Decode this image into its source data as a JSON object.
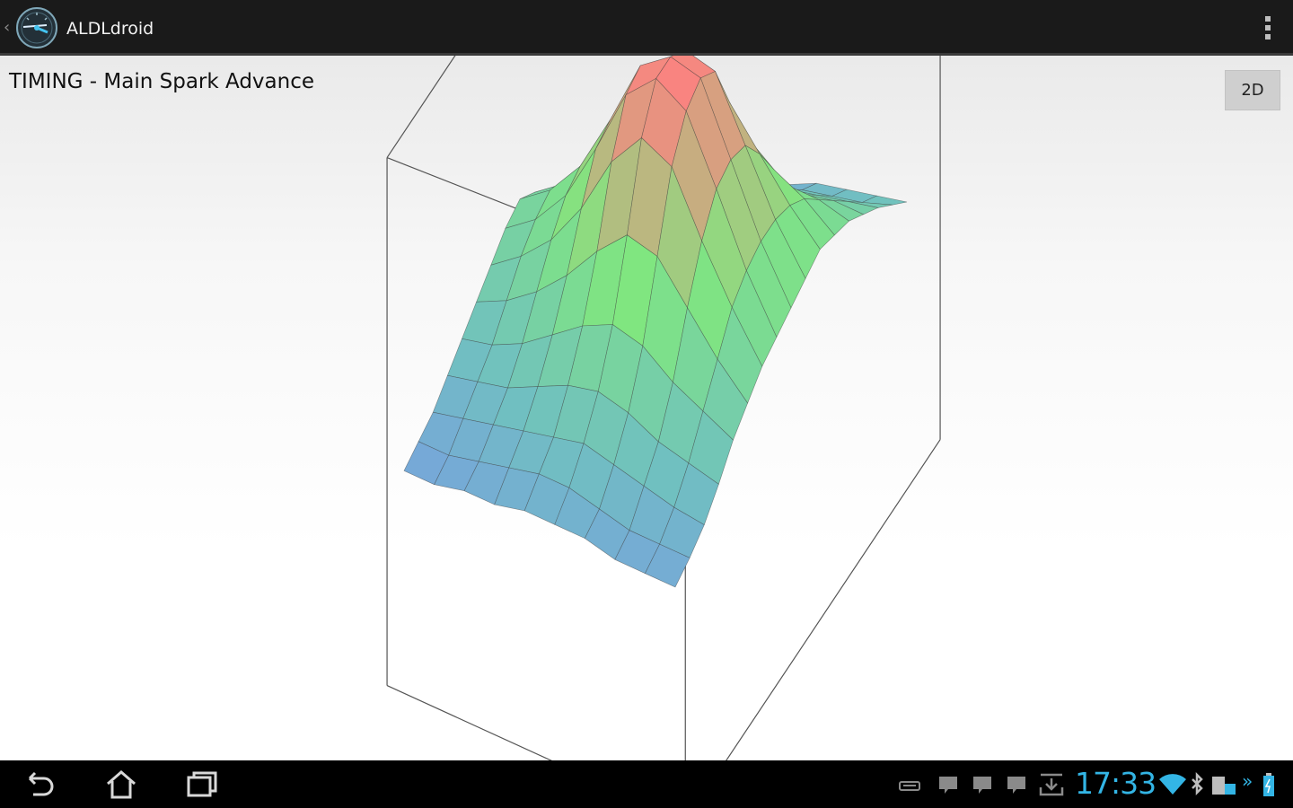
{
  "app": {
    "title": "ALDLdroid"
  },
  "header": {
    "map_title": "TIMING - Main Spark Advance",
    "view_toggle_label": "2D"
  },
  "status_bar": {
    "time": "17:33"
  },
  "icons": {
    "app": "gauge-icon",
    "overflow": "overflow-menu-icon",
    "back": "back-icon",
    "home": "home-icon",
    "recents": "recents-icon",
    "notifications": [
      "keyboard-icon",
      "chat-icon",
      "chat-icon",
      "chat-icon",
      "download-icon"
    ],
    "status": [
      "wifi-icon",
      "bluetooth-icon",
      "sd-card-icon",
      "more-icon",
      "battery-icon"
    ]
  },
  "colors": {
    "clock": "#33b5e5",
    "surface_high": "#ff8080",
    "surface_mid": "#80e080",
    "surface_low_mid": "#70c0c0",
    "surface_low": "#8080ff"
  },
  "chart_data": {
    "type": "surface",
    "grid_rows": 10,
    "grid_cols": 17,
    "values": [
      [
        0.2,
        0.22,
        0.25,
        0.3,
        0.36,
        0.4,
        0.44,
        0.46,
        0.48,
        0.5,
        0.52,
        0.5,
        0.48,
        0.44,
        0.4,
        0.35,
        0.3
      ],
      [
        0.2,
        0.22,
        0.26,
        0.32,
        0.4,
        0.48,
        0.56,
        0.6,
        0.62,
        0.62,
        0.6,
        0.56,
        0.5,
        0.44,
        0.38,
        0.32,
        0.28
      ],
      [
        0.2,
        0.22,
        0.28,
        0.34,
        0.44,
        0.58,
        0.7,
        0.78,
        0.8,
        0.78,
        0.7,
        0.6,
        0.5,
        0.42,
        0.36,
        0.3,
        0.26
      ],
      [
        0.22,
        0.24,
        0.3,
        0.38,
        0.5,
        0.68,
        0.86,
        0.95,
        0.98,
        0.94,
        0.8,
        0.66,
        0.52,
        0.42,
        0.34,
        0.28,
        0.24
      ],
      [
        0.22,
        0.26,
        0.32,
        0.4,
        0.52,
        0.7,
        0.9,
        1.0,
        1.0,
        0.96,
        0.82,
        0.66,
        0.5,
        0.38,
        0.3,
        0.24,
        0.2
      ],
      [
        0.22,
        0.26,
        0.3,
        0.38,
        0.48,
        0.62,
        0.8,
        0.92,
        0.94,
        0.88,
        0.74,
        0.58,
        0.42,
        0.3,
        0.22,
        0.16,
        0.12
      ],
      [
        0.2,
        0.24,
        0.28,
        0.34,
        0.42,
        0.52,
        0.64,
        0.74,
        0.76,
        0.7,
        0.58,
        0.44,
        0.3,
        0.18,
        0.1,
        0.06,
        0.04
      ],
      [
        0.2,
        0.22,
        0.26,
        0.3,
        0.36,
        0.44,
        0.52,
        0.58,
        0.6,
        0.56,
        0.46,
        0.34,
        0.2,
        0.1,
        0.04,
        0.02,
        0.02
      ],
      [
        0.18,
        0.2,
        0.24,
        0.28,
        0.32,
        0.38,
        0.44,
        0.48,
        0.5,
        0.46,
        0.38,
        0.28,
        0.16,
        0.06,
        0.02,
        0.0,
        0.0
      ],
      [
        0.18,
        0.2,
        0.22,
        0.26,
        0.3,
        0.34,
        0.38,
        0.42,
        0.44,
        0.4,
        0.34,
        0.24,
        0.14,
        0.05,
        0.02,
        0.0,
        0.0
      ]
    ]
  }
}
